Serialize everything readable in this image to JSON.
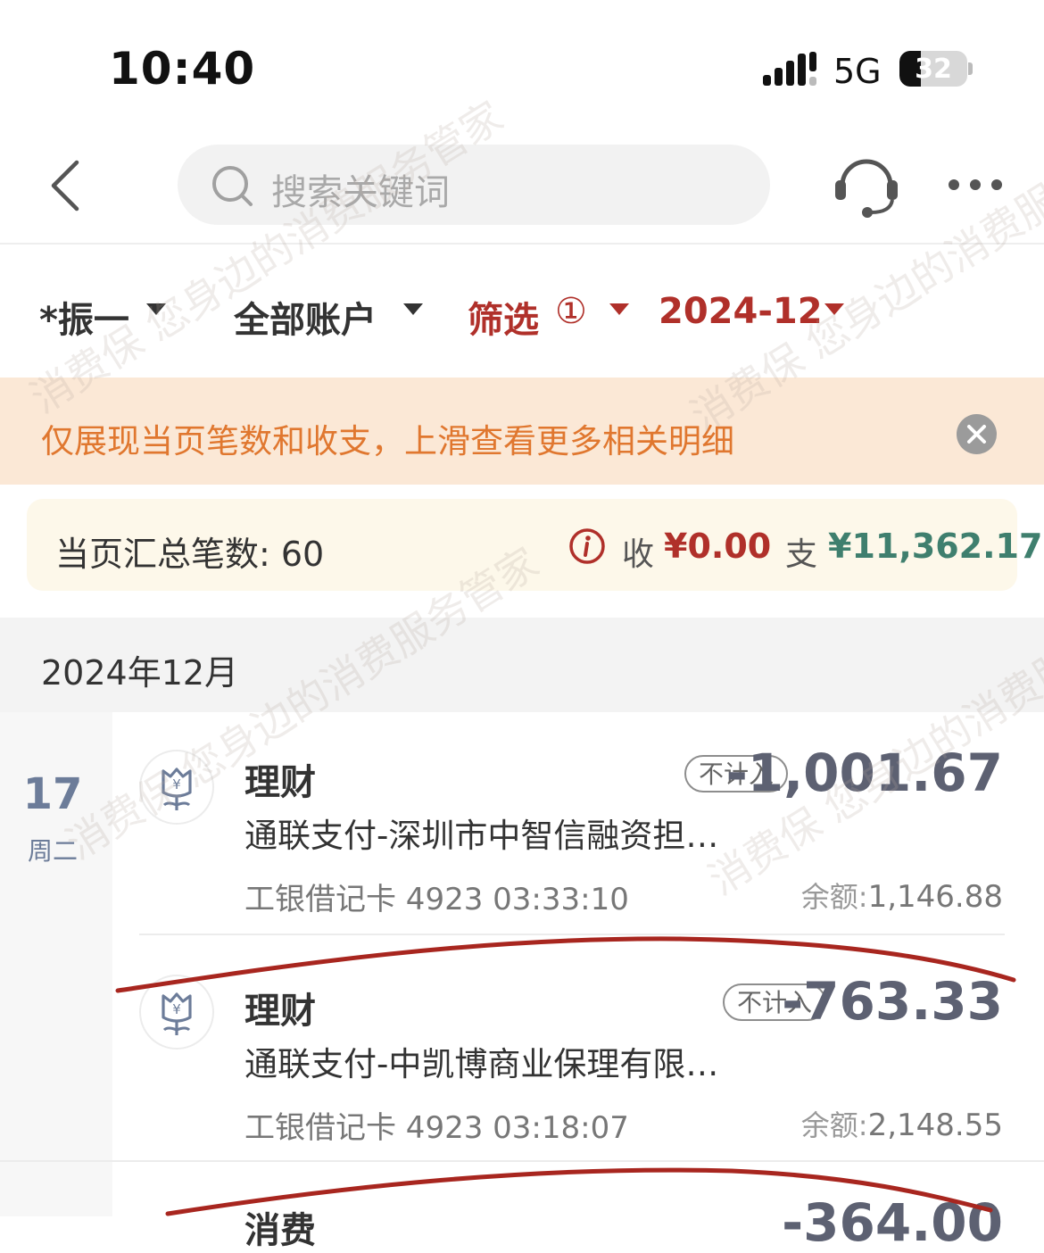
{
  "status_bar": {
    "time": "10:40",
    "network": "5G",
    "battery": "32",
    "battery_level": 0.32
  },
  "header": {
    "search_placeholder": "搜索关键词"
  },
  "filters": {
    "person": "*振一",
    "accounts": "全部账户",
    "filter_label": "筛选",
    "filter_count": "①",
    "month": "2024-12"
  },
  "banner": {
    "text": "仅展现当页笔数和收支，上滑查看更多相关明细"
  },
  "summary": {
    "count_label": "当页汇总笔数: 60",
    "income_label": "收",
    "income_value": "¥0.00",
    "expense_label": "支",
    "expense_value": "¥11,362.17"
  },
  "month_section": {
    "title": "2024年12月",
    "day": "17",
    "weekday": "周二"
  },
  "transactions": [
    {
      "category": "理财",
      "badge": "不计入",
      "amount": "-1,001.67",
      "description": "通联支付-深圳市中智信融资担…",
      "account_time": "工银借记卡 4923 03:33:10",
      "balance_label": "余额:",
      "balance": "1,146.88"
    },
    {
      "category": "理财",
      "badge": "不计入",
      "amount": "-763.33",
      "description": "通联支付-中凯博商业保理有限…",
      "account_time": "工银借记卡 4923 03:18:07",
      "balance_label": "余额:",
      "balance": "2,148.55"
    }
  ],
  "partial_next": {
    "category": "消费",
    "amount": "-364.00"
  },
  "watermark": "消费保 您身边的消费服务管家",
  "colors": {
    "accent_red": "#b0302a",
    "expense_green": "#3f7f6e",
    "banner_bg": "#fbe8d6",
    "banner_text": "#e0772f",
    "annotation_red": "#a8261f"
  }
}
